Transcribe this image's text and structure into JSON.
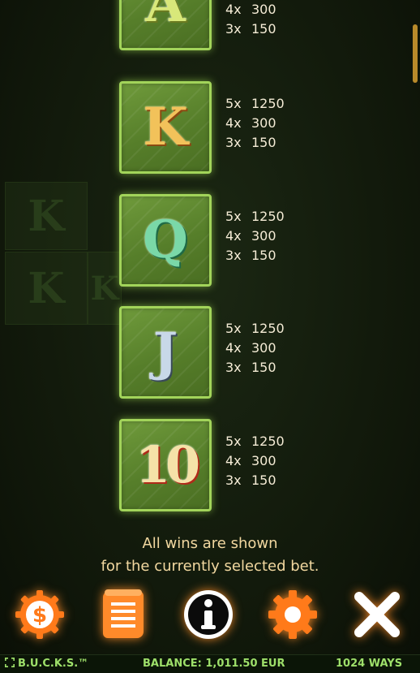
{
  "paytable": [
    {
      "symbol": "A",
      "pays": [
        {
          "count": "4x",
          "value": "300"
        },
        {
          "count": "3x",
          "value": "150"
        }
      ]
    },
    {
      "symbol": "K",
      "pays": [
        {
          "count": "5x",
          "value": "1250"
        },
        {
          "count": "4x",
          "value": "300"
        },
        {
          "count": "3x",
          "value": "150"
        }
      ]
    },
    {
      "symbol": "Q",
      "pays": [
        {
          "count": "5x",
          "value": "1250"
        },
        {
          "count": "4x",
          "value": "300"
        },
        {
          "count": "3x",
          "value": "150"
        }
      ]
    },
    {
      "symbol": "J",
      "pays": [
        {
          "count": "5x",
          "value": "1250"
        },
        {
          "count": "4x",
          "value": "300"
        },
        {
          "count": "3x",
          "value": "150"
        }
      ]
    },
    {
      "symbol": "10",
      "pays": [
        {
          "count": "5x",
          "value": "1250"
        },
        {
          "count": "4x",
          "value": "300"
        },
        {
          "count": "3x",
          "value": "150"
        }
      ]
    }
  ],
  "note": {
    "line1": "All wins are shown",
    "line2": "for the currently selected bet."
  },
  "toolbar": {
    "buttons": [
      "coin-bet-icon",
      "paytable-scroll-icon",
      "info-icon",
      "settings-gear-icon",
      "close-icon"
    ],
    "glow_color": "#ff7a1a"
  },
  "status": {
    "game_name": "B.U.C.K.S.™",
    "balance": "BALANCE: 1,011.50 EUR",
    "ways": "1024 WAYS"
  },
  "colors": {
    "tile_border": "#a2d45a",
    "text": "#f5ecd6",
    "note_text": "#f2d8a0",
    "status_text": "#9ee06a"
  }
}
